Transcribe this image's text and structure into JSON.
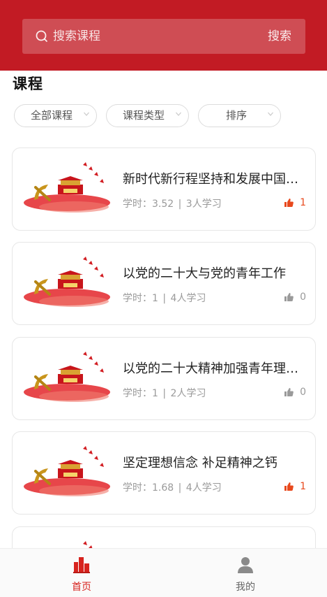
{
  "colors": {
    "brand": "#c21b24",
    "like_active": "#e8491d",
    "like_inactive": "#9a9a9a",
    "tab_active": "#d7231e",
    "tab_inactive": "#666666"
  },
  "search": {
    "placeholder": "搜索课程",
    "button_label": "搜索"
  },
  "page_title": "课程",
  "filters": [
    {
      "label": "全部课程",
      "icon": "chevron-down-icon"
    },
    {
      "label": "课程类型",
      "icon": "chevron-down-icon"
    },
    {
      "label": "排序",
      "icon": "chevron-down-icon"
    }
  ],
  "courses": [
    {
      "title": "新时代新行程坚持和发展中国特色社会主义",
      "hours_label": "学时：",
      "hours": "3.52",
      "learners": "3人学习",
      "likes": "1",
      "liked": true
    },
    {
      "title": "以党的二十大与党的青年工作",
      "hours_label": "学时：",
      "hours": "1",
      "learners": "4人学习",
      "likes": "0",
      "liked": false
    },
    {
      "title": "以党的二十大精神加强青年理想信念",
      "hours_label": "学时：",
      "hours": "1",
      "learners": "2人学习",
      "likes": "0",
      "liked": false
    },
    {
      "title": "坚定理想信念 补足精神之钙",
      "hours_label": "学时：",
      "hours": "1.68",
      "learners": "4人学习",
      "likes": "1",
      "liked": true
    }
  ],
  "tabbar": [
    {
      "label": "首页",
      "icon": "home-icon",
      "active": true
    },
    {
      "label": "我的",
      "icon": "user-icon",
      "active": false
    }
  ]
}
